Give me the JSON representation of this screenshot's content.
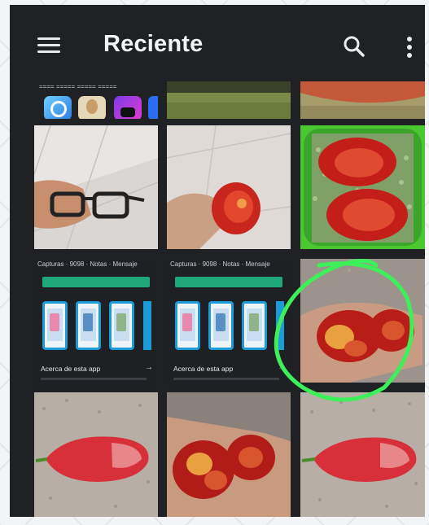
{
  "appbar": {
    "title": "Reciente",
    "menu_icon": "hamburger-menu-icon",
    "search_icon": "search-icon",
    "more_icon": "more-vert-icon"
  },
  "tiles": {
    "partial_screenshot_text": "==== ===== ===== =====",
    "app_screenshot_1": {
      "header": "Capturas · 9098 · Notas · Mensaje",
      "footer": "Acerca de esta app",
      "chevron": "→"
    },
    "app_screenshot_2": {
      "header": "Capturas · 9098 · Notas · Mensaje",
      "footer": "Acerca de esta app",
      "chevron": "→"
    }
  },
  "colors": {
    "background": "#202124",
    "text": "#f1f3f4",
    "annotation": "#3df05a",
    "accent": "#1fa97a"
  }
}
